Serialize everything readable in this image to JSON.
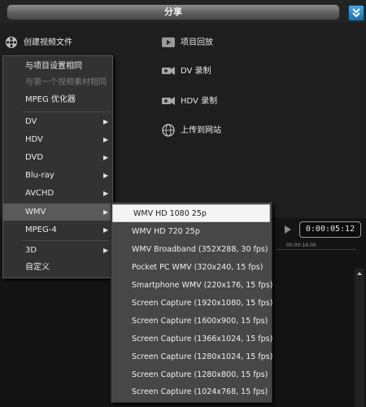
{
  "header": {
    "title": "分享"
  },
  "panel": {
    "create_video": "创建视频文件",
    "project_playback": "项目回放",
    "dv_record": "DV 录制",
    "hdv_record": "HDV 录制",
    "upload_web": "上传到网站"
  },
  "menu": {
    "items": [
      {
        "label": "与项目设置相同",
        "disabled": false
      },
      {
        "label": "与第一个视频素材相同",
        "disabled": true
      },
      {
        "label": "MPEG 优化器",
        "disabled": false
      },
      {
        "label": "DV",
        "submenu": true
      },
      {
        "label": "HDV",
        "submenu": true
      },
      {
        "label": "DVD",
        "submenu": true
      },
      {
        "label": "Blu-ray",
        "submenu": true
      },
      {
        "label": "AVCHD",
        "submenu": true
      },
      {
        "label": "WMV",
        "submenu": true,
        "highlighted": true
      },
      {
        "label": "MPEG-4",
        "submenu": true
      },
      {
        "label": "3D",
        "submenu": true
      },
      {
        "label": "自定义"
      }
    ]
  },
  "submenu": {
    "items": [
      {
        "label": "WMV HD 1080 25p",
        "selected": true
      },
      {
        "label": "WMV HD 720 25p"
      },
      {
        "label": "WMV Broadband  (352X288, 30 fps)"
      },
      {
        "label": "Pocket PC WMV  (320x240, 15 fps)"
      },
      {
        "label": "Smartphone WMV  (220x176, 15 fps)"
      },
      {
        "label": "Screen Capture (1920x1080, 15 fps)"
      },
      {
        "label": "Screen Capture (1600x900, 15 fps)"
      },
      {
        "label": "Screen Capture (1366x1024, 15 fps)"
      },
      {
        "label": "Screen Capture (1280x1024, 15 fps)"
      },
      {
        "label": "Screen Capture (1280x800, 15 fps)"
      },
      {
        "label": "Screen Capture (1024x768, 15 fps)"
      }
    ]
  },
  "timeline": {
    "timecode": "0:00:05:12",
    "ruler_mark": "00:00:14:00"
  },
  "colors": {
    "accent": "#2a8ad0",
    "menu_bg": "#323232",
    "submenu_bg": "#474747",
    "selected_bg": "#f4f4f4"
  }
}
